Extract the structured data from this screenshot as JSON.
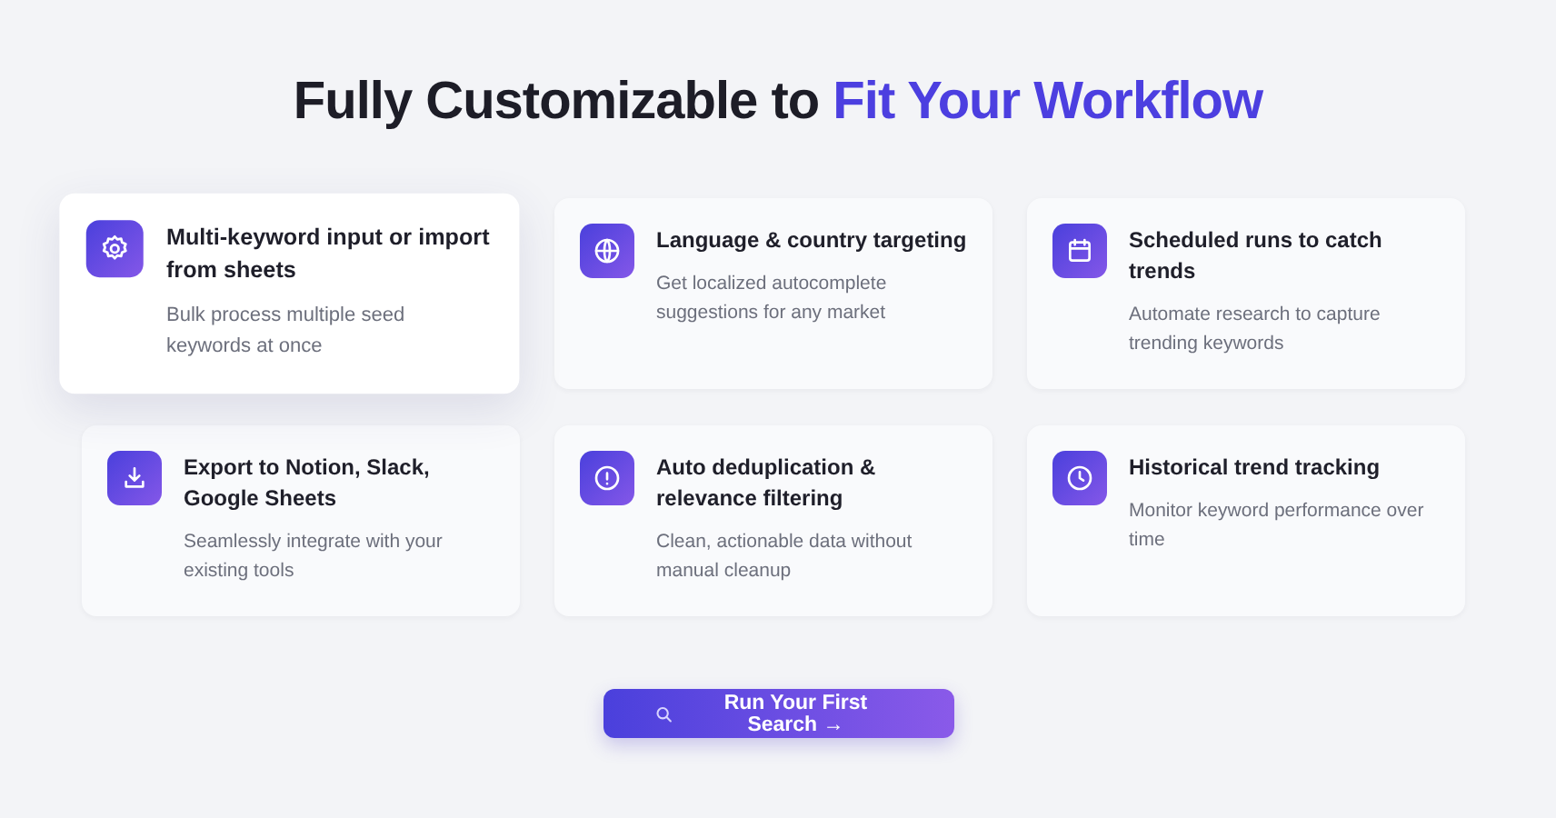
{
  "heading": {
    "text": "Fully Customizable to ",
    "accent": "Fit Your Workflow"
  },
  "features": [
    {
      "title": "Multi-keyword input or import from sheets",
      "description": "Bulk process multiple seed keywords at once",
      "highlighted": true
    },
    {
      "title": "Language & country targeting",
      "description": "Get localized autocomplete suggestions for any market",
      "highlighted": false
    },
    {
      "title": "Scheduled runs to catch trends",
      "description": "Automate research to capture trending keywords",
      "highlighted": false
    },
    {
      "title": "Export to Notion, Slack, Google Sheets",
      "description": "Seamlessly integrate with your existing tools",
      "highlighted": false
    },
    {
      "title": "Auto deduplication & relevance filtering",
      "description": "Clean, actionable data without manual cleanup",
      "highlighted": false
    },
    {
      "title": "Historical trend tracking",
      "description": "Monitor keyword performance over time",
      "highlighted": false
    }
  ],
  "cta": {
    "label": "Run Your First Search →"
  }
}
